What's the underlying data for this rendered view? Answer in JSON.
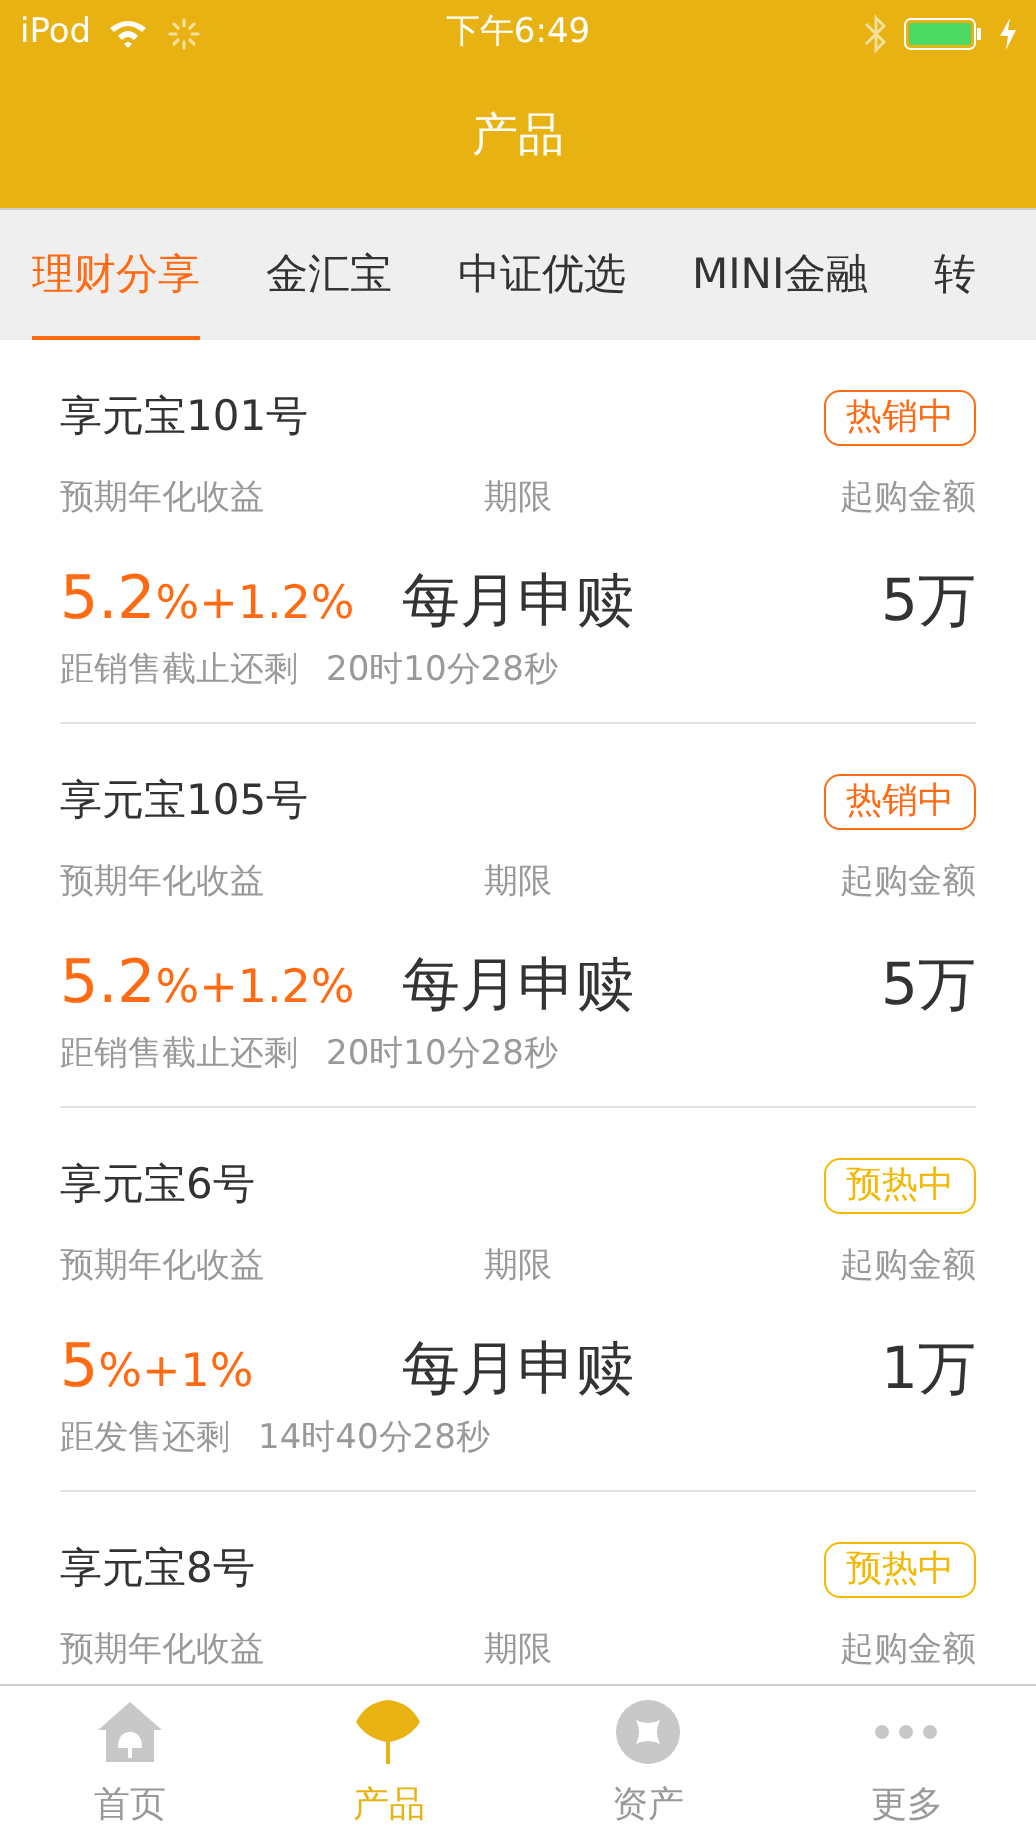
{
  "status_bar": {
    "carrier": "iPod",
    "time": "下午6:49"
  },
  "nav": {
    "title": "产品"
  },
  "tabs": [
    {
      "label": "理财分享",
      "selected": true
    },
    {
      "label": "金汇宝",
      "selected": false
    },
    {
      "label": "中证优选",
      "selected": false
    },
    {
      "label": "MINI金融",
      "selected": false
    },
    {
      "label": "转",
      "selected": false
    }
  ],
  "products": [
    {
      "name": "享元宝101号",
      "badge": {
        "kind": "hot",
        "label": "热销中"
      },
      "labels": [
        "预期年化收益",
        "期限",
        "起购金额"
      ],
      "rate_main": "5.2",
      "rate_extra": "%+1.2%",
      "term": "每月申赎",
      "min_amount": "5万",
      "countdown_label": "距销售截止还剩",
      "countdown": "20时10分28秒"
    },
    {
      "name": "享元宝105号",
      "badge": {
        "kind": "hot",
        "label": "热销中"
      },
      "labels": [
        "预期年化收益",
        "期限",
        "起购金额"
      ],
      "rate_main": "5.2",
      "rate_extra": "%+1.2%",
      "term": "每月申赎",
      "min_amount": "5万",
      "countdown_label": "距销售截止还剩",
      "countdown": "20时10分28秒"
    },
    {
      "name": "享元宝6号",
      "badge": {
        "kind": "preheat",
        "label": "预热中"
      },
      "labels": [
        "预期年化收益",
        "期限",
        "起购金额"
      ],
      "rate_main": "5",
      "rate_extra": "%+1%",
      "term": "每月申赎",
      "min_amount": "1万",
      "countdown_label": "距发售还剩",
      "countdown": "14时40分28秒"
    },
    {
      "name": "享元宝8号",
      "badge": {
        "kind": "preheat",
        "label": "预热中"
      },
      "labels": [
        "预期年化收益",
        "期限",
        "起购金额"
      ]
    }
  ],
  "tab_bar": [
    {
      "kind": "home",
      "label": "首页",
      "selected": false
    },
    {
      "kind": "product",
      "label": "产品",
      "selected": true
    },
    {
      "kind": "assets",
      "label": "资产",
      "selected": false
    },
    {
      "kind": "more",
      "label": "更多",
      "selected": false
    }
  ]
}
